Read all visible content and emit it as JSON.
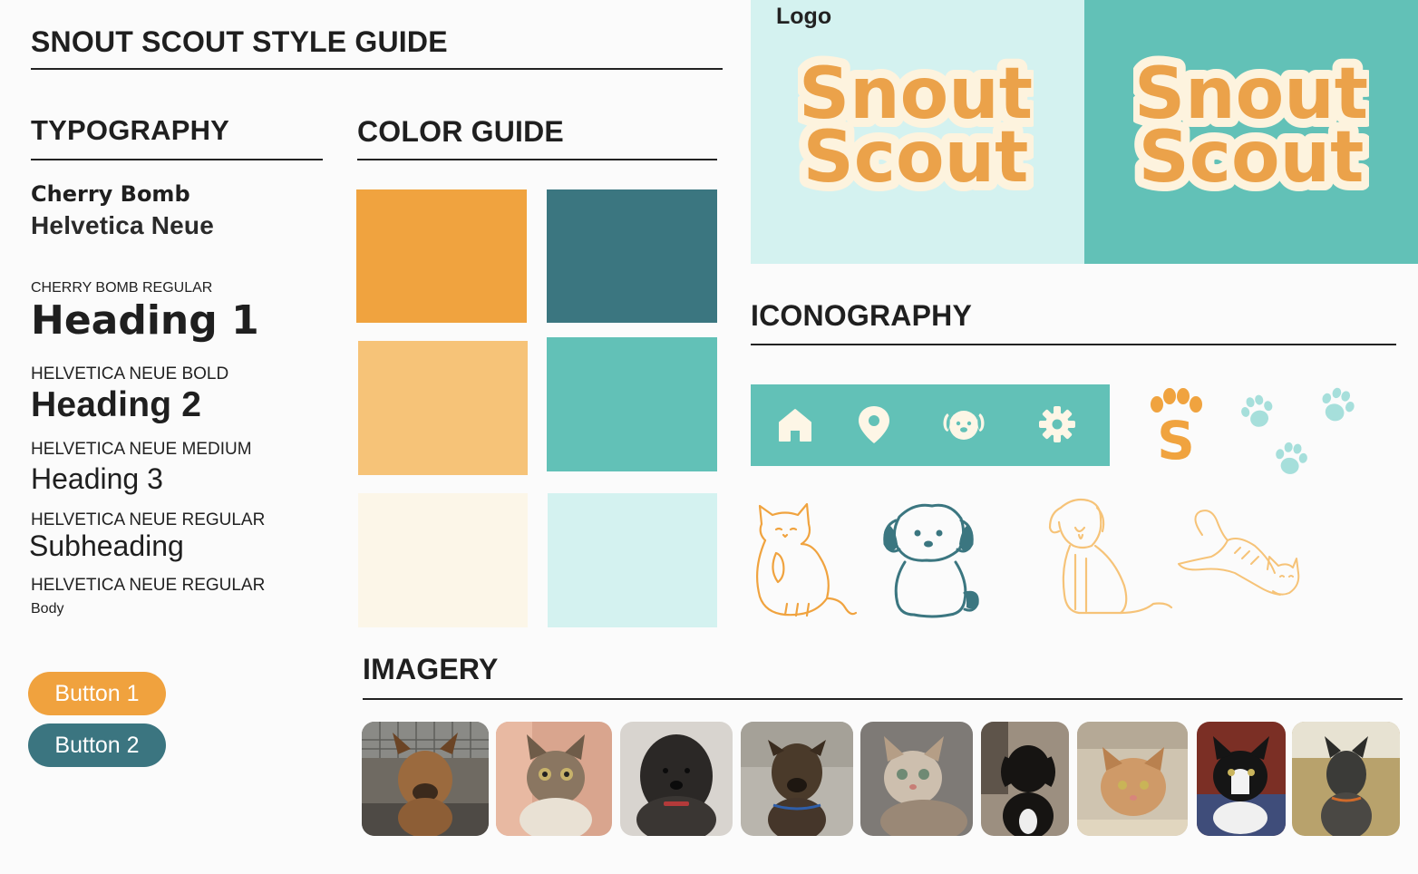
{
  "title": "SNOUT SCOUT STYLE GUIDE",
  "typography": {
    "heading": "TYPOGRAPHY",
    "font_primary": "Cherry Bomb",
    "font_secondary": "Helvetica Neue",
    "samples": [
      {
        "label": "CHERRY BOMB REGULAR",
        "sample": "Heading 1"
      },
      {
        "label": "HELVETICA NEUE BOLD",
        "sample": "Heading 2"
      },
      {
        "label": "HELVETICA NEUE MEDIUM",
        "sample": "Heading 3"
      },
      {
        "label": "HELVETICA NEUE REGULAR",
        "sample": "Subheading"
      },
      {
        "label": "HELVETICA NEUE REGULAR",
        "sample": "Body"
      }
    ]
  },
  "buttons": {
    "button1": {
      "label": "Button 1",
      "color": "#f0a23e"
    },
    "button2": {
      "label": "Button 2",
      "color": "#3b7580"
    }
  },
  "color_guide": {
    "heading": "COLOR GUIDE",
    "swatches": [
      "#f0a33f",
      "#3b7680",
      "#f6c378",
      "#62c1b7",
      "#fcf6e8",
      "#d4f2f0"
    ]
  },
  "logo": {
    "heading": "Logo",
    "wordmark_line1": "Snout",
    "wordmark_line2": "Scout",
    "panel_colors": [
      "#d4f2f0",
      "#62c1b7"
    ],
    "wordmark_color": "#eba24a",
    "outline_color": "#fdf3de"
  },
  "iconography": {
    "heading": "ICONOGRAPHY",
    "nav_icons": [
      "home-icon",
      "location-pin-icon",
      "dog-face-icon",
      "gear-icon"
    ],
    "badge_letter": "S",
    "paw_icons": [
      "paw-icon",
      "paw-icon",
      "paw-icon",
      "paw-icon"
    ],
    "illustrations": [
      "cat-illustration",
      "fluffy-dog-illustration",
      "golden-dog-illustration",
      "stretching-cat-illustration"
    ]
  },
  "imagery": {
    "heading": "IMAGERY",
    "photos": [
      "dog-photo",
      "cat-photo",
      "dog-photo",
      "dog-photo",
      "cat-photo",
      "dog-photo",
      "cat-photo",
      "cat-photo",
      "dog-photo"
    ]
  }
}
